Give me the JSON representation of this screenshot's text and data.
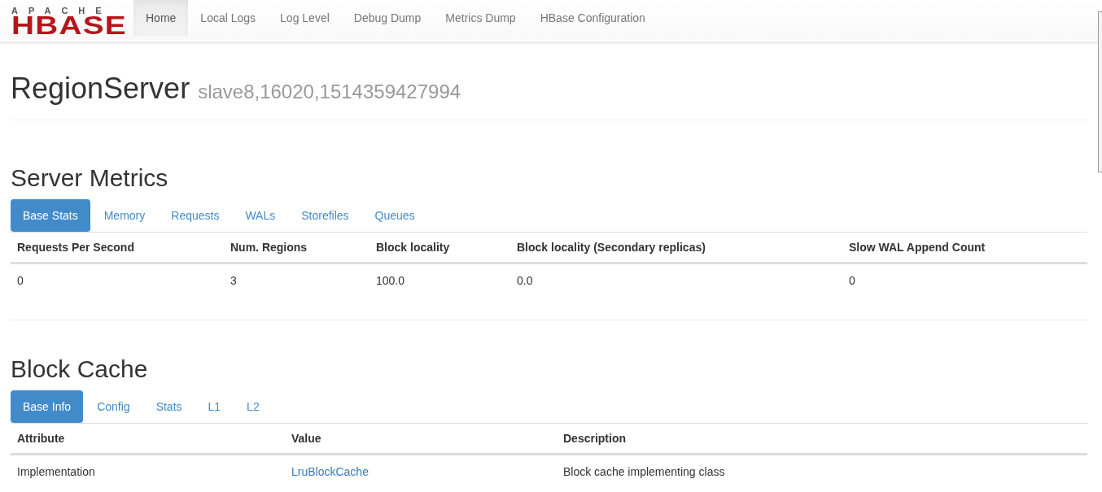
{
  "logo": {
    "top": "APACHE",
    "main": "HBASE"
  },
  "nav": [
    {
      "label": "Home",
      "selected": true
    },
    {
      "label": "Local Logs",
      "selected": false
    },
    {
      "label": "Log Level",
      "selected": false
    },
    {
      "label": "Debug Dump",
      "selected": false
    },
    {
      "label": "Metrics Dump",
      "selected": false
    },
    {
      "label": "HBase Configuration",
      "selected": false
    }
  ],
  "page_header": {
    "title": "RegionServer",
    "subtitle": "slave8,16020,1514359427994"
  },
  "sections": [
    {
      "title": "Server Metrics",
      "tabs": [
        {
          "label": "Base Stats",
          "selected": true
        },
        {
          "label": "Memory",
          "selected": false
        },
        {
          "label": "Requests",
          "selected": false
        },
        {
          "label": "WALs",
          "selected": false
        },
        {
          "label": "Storefiles",
          "selected": false
        },
        {
          "label": "Queues",
          "selected": false
        }
      ],
      "columns": [
        "Requests Per Second",
        "Num. Regions",
        "Block locality",
        "Block locality (Secondary replicas)",
        "Slow WAL Append Count"
      ],
      "rows": [
        [
          {
            "text": "0",
            "kind": "text"
          },
          {
            "text": "3",
            "kind": "text"
          },
          {
            "text": "100.0",
            "kind": "text"
          },
          {
            "text": "0.0",
            "kind": "text"
          },
          {
            "text": "0",
            "kind": "text"
          }
        ]
      ]
    },
    {
      "title": "Block Cache",
      "tabs": [
        {
          "label": "Base Info",
          "selected": true
        },
        {
          "label": "Config",
          "selected": false
        },
        {
          "label": "Stats",
          "selected": false
        },
        {
          "label": "L1",
          "selected": false
        },
        {
          "label": "L2",
          "selected": false
        }
      ],
      "columns": [
        "Attribute",
        "Value",
        "Description"
      ],
      "rows": [
        [
          {
            "text": "Implementation",
            "kind": "text"
          },
          {
            "text": "LruBlockCache",
            "kind": "link"
          },
          {
            "text": "Block cache implementing class",
            "kind": "text"
          }
        ]
      ]
    }
  ]
}
